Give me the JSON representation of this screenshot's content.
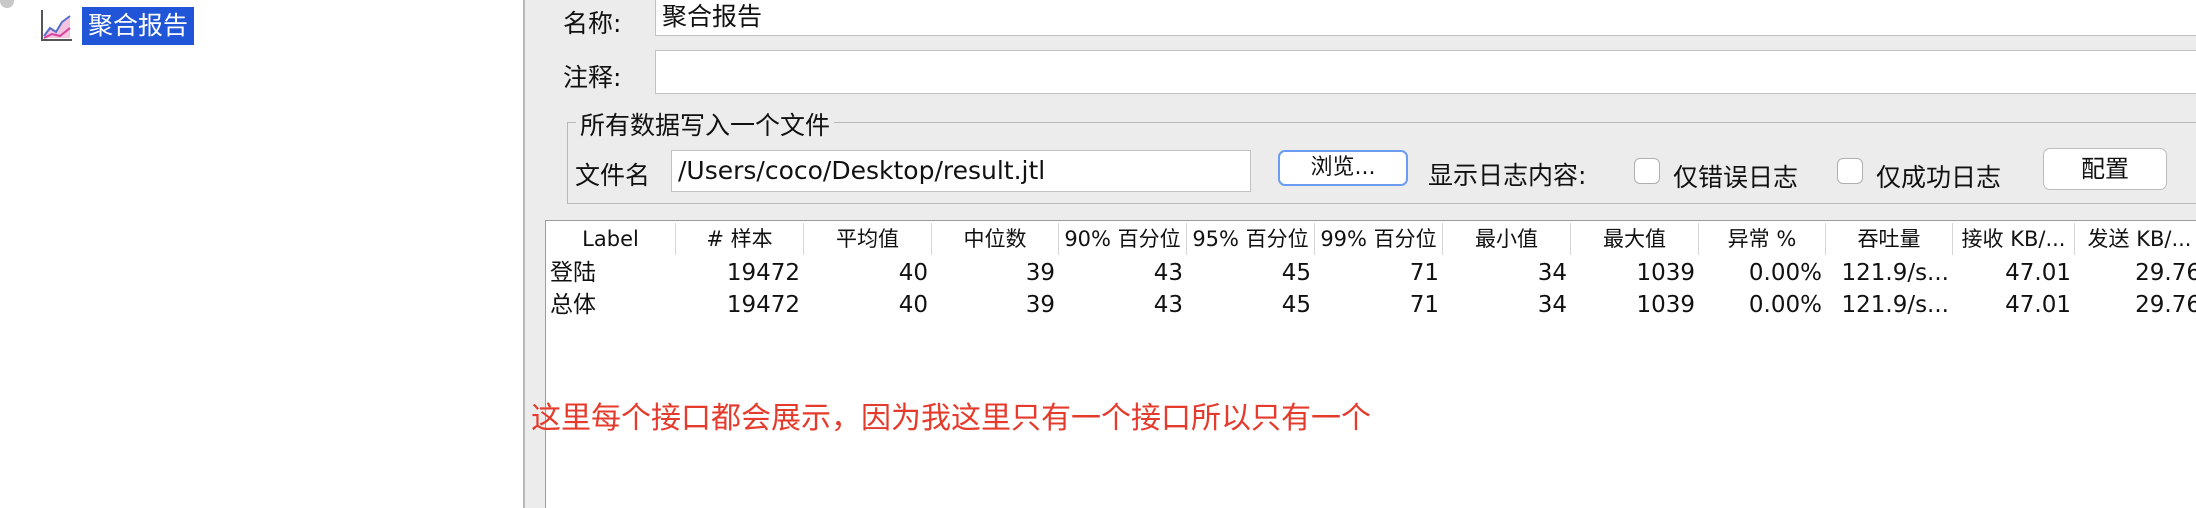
{
  "tree": {
    "selected_label": "聚合报告",
    "icon": "line-chart-icon"
  },
  "form": {
    "name_label": "名称:",
    "name_value": "聚合报告",
    "comment_label": "注释:",
    "comment_value": "",
    "group_title": "所有数据写入一个文件",
    "file_label": "文件名",
    "file_value": "/Users/coco/Desktop/result.jtl",
    "browse_label": "浏览...",
    "log_label": "显示日志内容:",
    "errors_only_label": "仅错误日志",
    "errors_only_checked": false,
    "success_only_label": "仅成功日志",
    "success_only_checked": false,
    "config_label": "配置"
  },
  "table": {
    "headers": [
      "Label",
      "# 样本",
      "平均值",
      "中位数",
      "90% 百分位",
      "95% 百分位",
      "99% 百分位",
      "最小值",
      "最大值",
      "异常 %",
      "吞吐量",
      "接收 KB/...",
      "发送 KB/..."
    ],
    "rows": [
      [
        "登陆",
        "19472",
        "40",
        "39",
        "43",
        "45",
        "71",
        "34",
        "1039",
        "0.00%",
        "121.9/s...",
        "47.01",
        "29.76"
      ],
      [
        "总体",
        "19472",
        "40",
        "39",
        "43",
        "45",
        "71",
        "34",
        "1039",
        "0.00%",
        "121.9/s...",
        "47.01",
        "29.76"
      ]
    ]
  },
  "annotation": "这里每个接口都会展示，因为我这里只有一个接口所以只有一个",
  "colors": {
    "selection": "#1f55d6",
    "annotation": "#e53b2c",
    "focus_border": "#6a9cf2"
  }
}
